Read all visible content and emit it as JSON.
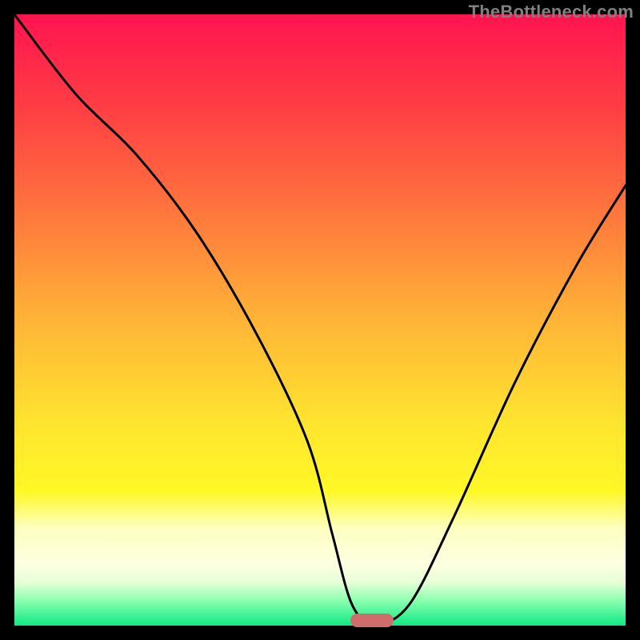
{
  "watermark": "TheBottleneck.com",
  "colors": {
    "pill": "#cf6d6c",
    "curve": "#000000"
  },
  "chart_data": {
    "type": "line",
    "title": "",
    "xlabel": "",
    "ylabel": "",
    "xlim": [
      0,
      100
    ],
    "ylim": [
      0,
      100
    ],
    "series": [
      {
        "name": "bottleneck-curve",
        "x": [
          0,
          10,
          20,
          30,
          40,
          48,
          52,
          55,
          58,
          60,
          65,
          72,
          82,
          92,
          100
        ],
        "y_pct": [
          100,
          87,
          77,
          64,
          47,
          30,
          15,
          4,
          0,
          0,
          4,
          18,
          40,
          59,
          72
        ]
      }
    ],
    "marker": {
      "x_start_pct": 55,
      "x_end_pct": 62,
      "y_pct": 0
    }
  }
}
